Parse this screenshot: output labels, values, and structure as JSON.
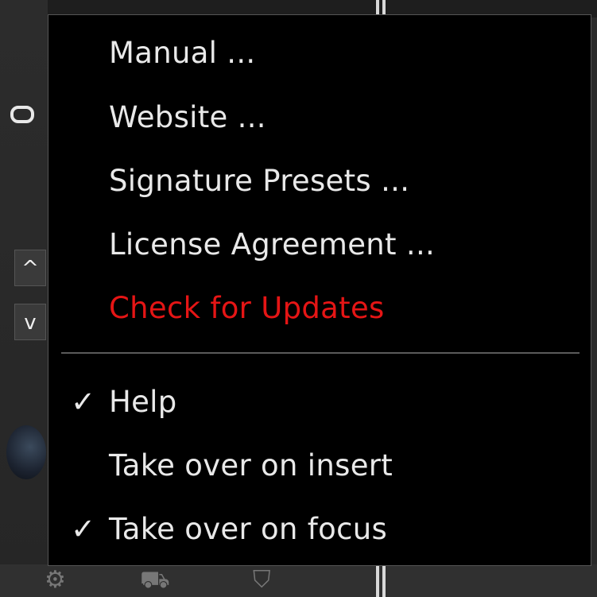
{
  "menu": {
    "top_items": [
      {
        "label": "Manual ...",
        "checked": false
      },
      {
        "label": "Website ...",
        "checked": false
      },
      {
        "label": "Signature Presets ...",
        "checked": false
      },
      {
        "label": "License Agreement ...",
        "checked": false
      },
      {
        "label": "Check for Updates",
        "checked": false,
        "color": "#e51515"
      }
    ],
    "bottom_items": [
      {
        "label": "Help",
        "checked": true
      },
      {
        "label": "Take over on insert",
        "checked": false
      },
      {
        "label": "Take over on focus",
        "checked": true
      }
    ],
    "check_glyph": "✓"
  },
  "background": {
    "up_arrow": "^",
    "down_arrow": "v"
  },
  "colors": {
    "menu_background": "#000000",
    "menu_text": "#e9e9e9",
    "highlight_text": "#e51515"
  }
}
